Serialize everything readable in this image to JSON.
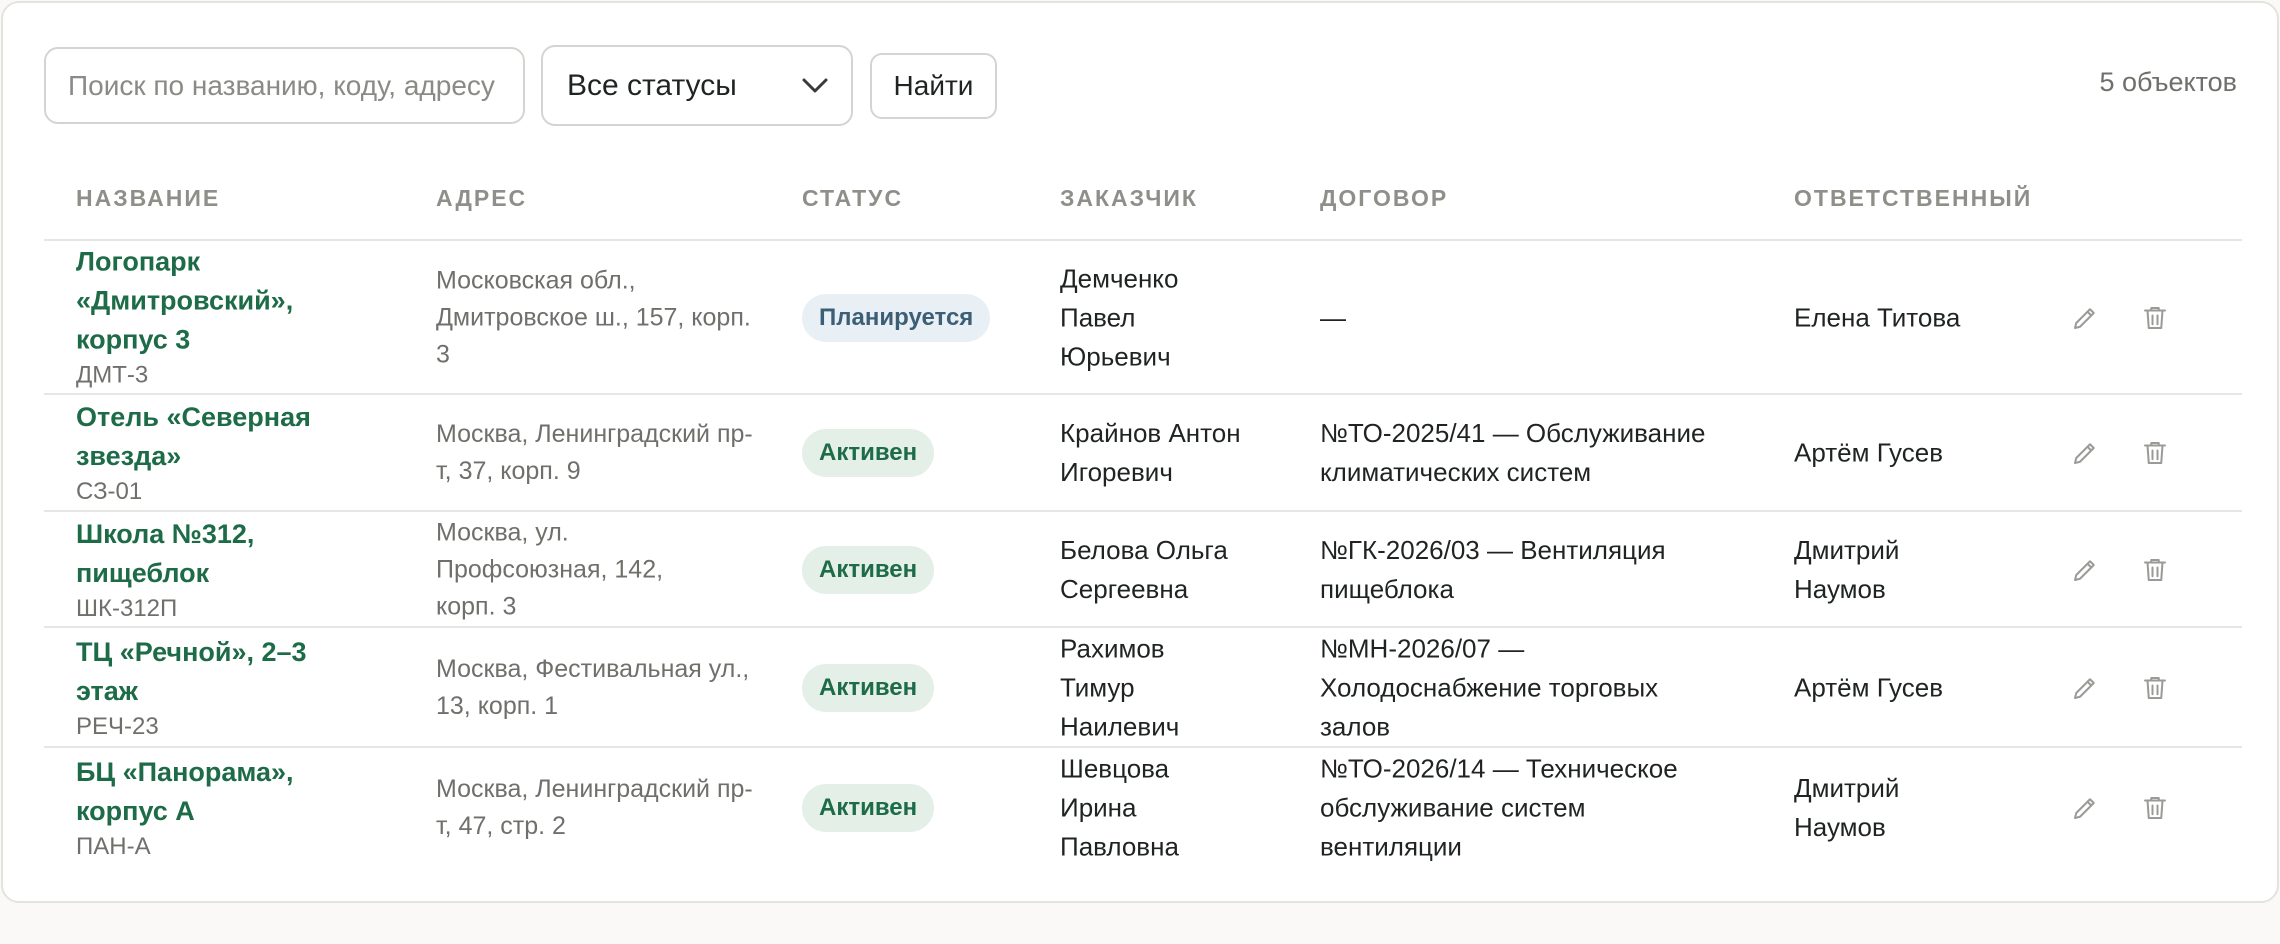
{
  "toolbar": {
    "search_placeholder": "Поиск по названию, коду, адресу",
    "status_select": "Все статусы",
    "find_label": "Найти",
    "count_text": "5 объектов"
  },
  "table": {
    "headers": {
      "name": "Название",
      "address": "Адрес",
      "status": "Статус",
      "customer": "Заказчик",
      "contract": "Договор",
      "responsible": "Ответственный"
    },
    "rows": [
      {
        "name": "Логопарк «Дмитровский», корпус 3",
        "code": "ДМТ-3",
        "address": "Московская обл., Дмитровское ш., 157, корп. 3",
        "status": "Планируется",
        "customer": "Демченко Павел Юрьевич",
        "contract": "—",
        "responsible": "Елена Титова"
      },
      {
        "name": "Отель «Северная звезда»",
        "code": "СЗ-01",
        "address": "Москва, Ленинградский пр-т, 37, корп. 9",
        "status": "Активен",
        "customer": "Крайнов Антон Игоревич",
        "contract": "№ТО-2025/41 — Обслуживание климатических систем",
        "responsible": "Артём Гусев"
      },
      {
        "name": "Школа №312, пищеблок",
        "code": "ШК-312П",
        "address": "Москва, ул. Профсоюзная, 142, корп. 3",
        "status": "Активен",
        "customer": "Белова Ольга Сергеевна",
        "contract": "№ГК-2026/03 — Вентиляция пищеблока",
        "responsible": "Дмитрий Наумов"
      },
      {
        "name": "ТЦ «Речной», 2–3 этаж",
        "code": "РЕЧ-23",
        "address": "Москва, Фестивальная ул., 13, корп. 1",
        "status": "Активен",
        "customer": "Рахимов Тимур Наилевич",
        "contract": "№МН-2026/07 — Холодоснабжение торговых залов",
        "responsible": "Артём Гусев"
      },
      {
        "name": "БЦ «Панорама», корпус А",
        "code": "ПАН-А",
        "address": "Москва, Ленинградский пр-т, 47, стр. 2",
        "status": "Активен",
        "customer": "Шевцова Ирина Павловна",
        "contract": "№ТО-2026/14 — Техническое обслуживание систем вентиляции",
        "responsible": "Дмитрий Наумов"
      }
    ]
  },
  "icons": {
    "edit": "pencil-icon",
    "delete": "trash-icon",
    "select": "chevron-down-icon"
  },
  "colors": {
    "link": "#1e6b47",
    "badge_active_bg": "#e4efe8",
    "badge_planned_bg": "#e9f0f5",
    "badge_planned_text": "#3d5f76"
  }
}
